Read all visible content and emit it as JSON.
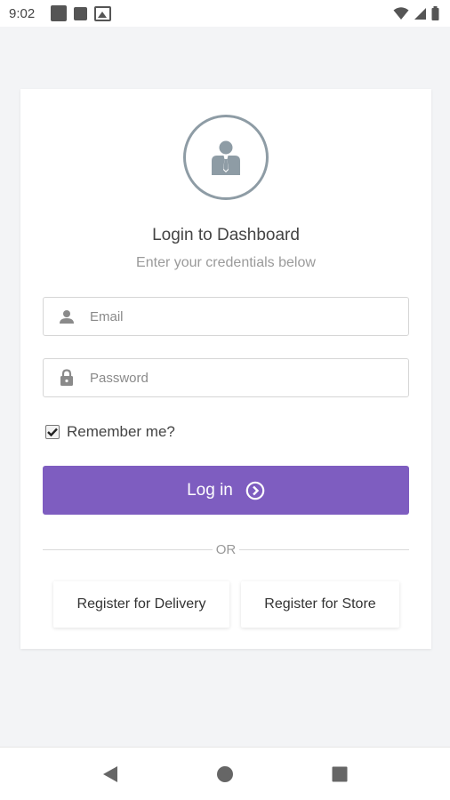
{
  "status_bar": {
    "time": "9:02",
    "left_icons": [
      "notification-square-icon",
      "notification-square-icon",
      "gallery-icon"
    ],
    "right_icons": [
      "wifi-icon",
      "signal-icon",
      "battery-icon"
    ]
  },
  "login": {
    "avatar_icon": "user-icon",
    "title": "Login to Dashboard",
    "subtitle": "Enter your credentials below",
    "email": {
      "placeholder": "Email",
      "value": "",
      "icon": "user-icon"
    },
    "password": {
      "placeholder": "Password",
      "value": "",
      "icon": "lock-icon"
    },
    "remember_label": "Remember me?",
    "remember_checked": true,
    "login_button": "Log in",
    "login_button_icon": "chevron-right-circle-icon",
    "separator": "OR",
    "register_delivery": "Register for Delivery",
    "register_store": "Register for Store"
  },
  "nav_bar": {
    "buttons": [
      "back-icon",
      "home-icon",
      "recents-icon"
    ]
  },
  "colors": {
    "accent": "#7e5dc0",
    "avatar_ring": "#8e9ca5",
    "background": "#f3f4f6"
  }
}
